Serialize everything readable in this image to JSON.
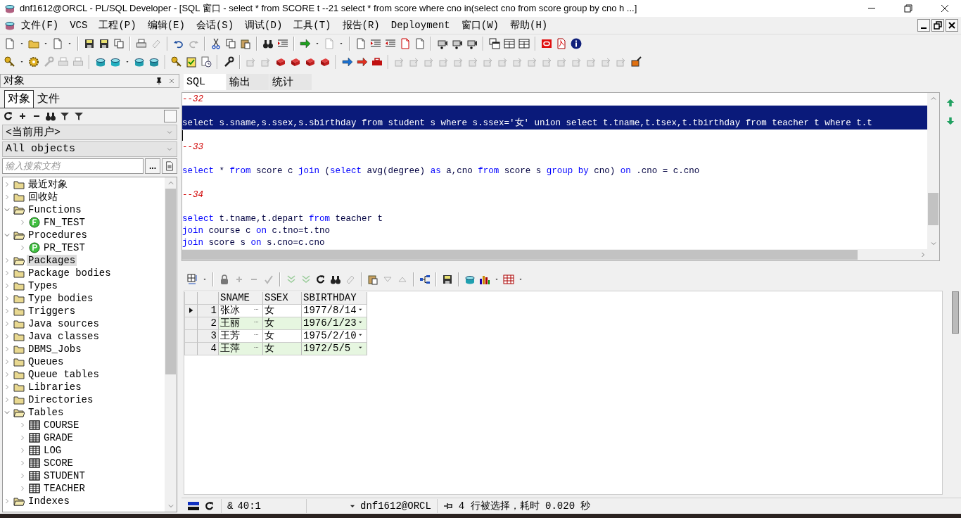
{
  "window": {
    "title": "dnf1612@ORCL - PL/SQL Developer - [SQL 窗口 - select * from SCORE t --21 select * from score where cno in(select cno from score group by cno h ...]"
  },
  "menu": [
    "文件(F)",
    "VCS",
    "工程(P)",
    "编辑(E)",
    "会话(S)",
    "调试(D)",
    "工具(T)",
    "报告(R)",
    "Deployment",
    "窗口(W)",
    "帮助(H)"
  ],
  "object_panel": {
    "title": "对象",
    "tabs": [
      {
        "label": "对象",
        "selected": true
      },
      {
        "label": "文件",
        "selected": false
      }
    ],
    "user_dropdown": "<当前用户>",
    "filter_dropdown": "All objects",
    "search": {
      "placeholder": "输入搜索文档"
    },
    "browse_button": "...",
    "tree": [
      {
        "label": "最近对象",
        "kind": "folder",
        "expanded": false,
        "selected": false
      },
      {
        "label": "回收站",
        "kind": "folder",
        "expanded": false,
        "selected": false
      },
      {
        "label": "Functions",
        "kind": "open-folder",
        "expanded": true,
        "selected": false,
        "children": [
          {
            "label": "FN_TEST",
            "kind": "function",
            "expanded": false,
            "selected": false
          }
        ]
      },
      {
        "label": "Procedures",
        "kind": "open-folder",
        "expanded": true,
        "selected": false,
        "children": [
          {
            "label": "PR_TEST",
            "kind": "procedure",
            "expanded": false,
            "selected": false
          }
        ]
      },
      {
        "label": "Packages",
        "kind": "open-folder",
        "expanded": false,
        "selected": true
      },
      {
        "label": "Package bodies",
        "kind": "folder",
        "expanded": false,
        "selected": false
      },
      {
        "label": "Types",
        "kind": "folder",
        "expanded": false,
        "selected": false
      },
      {
        "label": "Type bodies",
        "kind": "folder",
        "expanded": false,
        "selected": false
      },
      {
        "label": "Triggers",
        "kind": "folder",
        "expanded": false,
        "selected": false
      },
      {
        "label": "Java sources",
        "kind": "folder",
        "expanded": false,
        "selected": false
      },
      {
        "label": "Java classes",
        "kind": "folder",
        "expanded": false,
        "selected": false
      },
      {
        "label": "DBMS_Jobs",
        "kind": "folder",
        "expanded": false,
        "selected": false
      },
      {
        "label": "Queues",
        "kind": "folder",
        "expanded": false,
        "selected": false
      },
      {
        "label": "Queue tables",
        "kind": "folder",
        "expanded": false,
        "selected": false
      },
      {
        "label": "Libraries",
        "kind": "folder",
        "expanded": false,
        "selected": false
      },
      {
        "label": "Directories",
        "kind": "folder",
        "expanded": false,
        "selected": false
      },
      {
        "label": "Tables",
        "kind": "open-folder",
        "expanded": true,
        "selected": false,
        "children": [
          {
            "label": "COURSE",
            "kind": "table",
            "expanded": false,
            "selected": false
          },
          {
            "label": "GRADE",
            "kind": "table",
            "expanded": false,
            "selected": false
          },
          {
            "label": "LOG",
            "kind": "table",
            "expanded": false,
            "selected": false
          },
          {
            "label": "SCORE",
            "kind": "table",
            "expanded": false,
            "selected": false
          },
          {
            "label": "STUDENT",
            "kind": "table",
            "expanded": false,
            "selected": false
          },
          {
            "label": "TEACHER",
            "kind": "table",
            "expanded": false,
            "selected": false
          }
        ]
      },
      {
        "label": "Indexes",
        "kind": "open-folder",
        "expanded": false,
        "selected": false
      }
    ]
  },
  "editor_tabs": [
    {
      "label": "SQL",
      "selected": true
    },
    {
      "label": "输出",
      "selected": false
    },
    {
      "label": "统计",
      "selected": false
    }
  ],
  "editor": {
    "lines": [
      {
        "tokens": [
          {
            "text": "--32",
            "kind": "comment"
          }
        ],
        "selected": false,
        "cursor": false
      },
      {
        "selected": true,
        "cursor": false
      },
      {
        "tokens": [
          {
            "text": "select s.sname,s.ssex,s.sbirthday from student s where s.ssex='女' union select t.tname,t.tsex,t.tbirthday from teacher t where t.t",
            "kind": "plain"
          }
        ],
        "selected": true,
        "cursor": false
      },
      {
        "selected": false,
        "cursor": true
      },
      {
        "tokens": [
          {
            "text": "--33",
            "kind": "comment"
          }
        ],
        "selected": false,
        "cursor": false
      },
      {
        "selected": false,
        "cursor": false
      },
      {
        "tokens": [
          {
            "text": "select",
            "kind": "keyword"
          },
          {
            "text": " * ",
            "kind": "plain"
          },
          {
            "text": "from",
            "kind": "keyword"
          },
          {
            "text": " score c ",
            "kind": "plain"
          },
          {
            "text": "join",
            "kind": "keyword"
          },
          {
            "text": " (",
            "kind": "plain"
          },
          {
            "text": "select",
            "kind": "keyword"
          },
          {
            "text": " avg(degree) ",
            "kind": "plain"
          },
          {
            "text": "as",
            "kind": "keyword"
          },
          {
            "text": " a,cno ",
            "kind": "plain"
          },
          {
            "text": "from",
            "kind": "keyword"
          },
          {
            "text": " score s ",
            "kind": "plain"
          },
          {
            "text": "group by",
            "kind": "keyword"
          },
          {
            "text": " cno) ",
            "kind": "plain"
          },
          {
            "text": "on",
            "kind": "keyword"
          },
          {
            "text": " .cno = c.cno",
            "kind": "plain"
          }
        ],
        "selected": false,
        "cursor": false
      },
      {
        "selected": false,
        "cursor": false
      },
      {
        "tokens": [
          {
            "text": "--34",
            "kind": "comment"
          }
        ],
        "selected": false,
        "cursor": false
      },
      {
        "selected": false,
        "cursor": false
      },
      {
        "tokens": [
          {
            "text": "select",
            "kind": "keyword"
          },
          {
            "text": " t.tname,t.depart ",
            "kind": "plain"
          },
          {
            "text": "from",
            "kind": "keyword"
          },
          {
            "text": " teacher t",
            "kind": "plain"
          }
        ],
        "selected": false,
        "cursor": false
      },
      {
        "tokens": [
          {
            "text": "join",
            "kind": "keyword"
          },
          {
            "text": " course c ",
            "kind": "plain"
          },
          {
            "text": "on",
            "kind": "keyword"
          },
          {
            "text": " c.tno=t.tno",
            "kind": "plain"
          }
        ],
        "selected": false,
        "cursor": false
      },
      {
        "tokens": [
          {
            "text": "join",
            "kind": "keyword"
          },
          {
            "text": " score s ",
            "kind": "plain"
          },
          {
            "text": "on",
            "kind": "keyword"
          },
          {
            "text": " s.cno=c.cno",
            "kind": "plain"
          }
        ],
        "selected": false,
        "cursor": false
      }
    ]
  },
  "results": {
    "columns": [
      "SNAME",
      "SSEX",
      "SBIRTHDAY"
    ],
    "rows": [
      {
        "number": "1",
        "current": true,
        "cells": [
          "张冰",
          "女",
          "1977/8/14"
        ]
      },
      {
        "number": "2",
        "current": false,
        "cells": [
          "王丽",
          "女",
          "1976/1/23"
        ]
      },
      {
        "number": "3",
        "current": false,
        "cells": [
          "王芳",
          "女",
          "1975/2/10"
        ]
      },
      {
        "number": "4",
        "current": false,
        "cells": [
          "王萍",
          "女",
          "1972/5/5"
        ]
      }
    ]
  },
  "status_bar": {
    "mode": "&",
    "position": "40:1",
    "connection": "dnf1612@ORCL",
    "message": "4 行被选择，耗时 0.020 秒"
  }
}
